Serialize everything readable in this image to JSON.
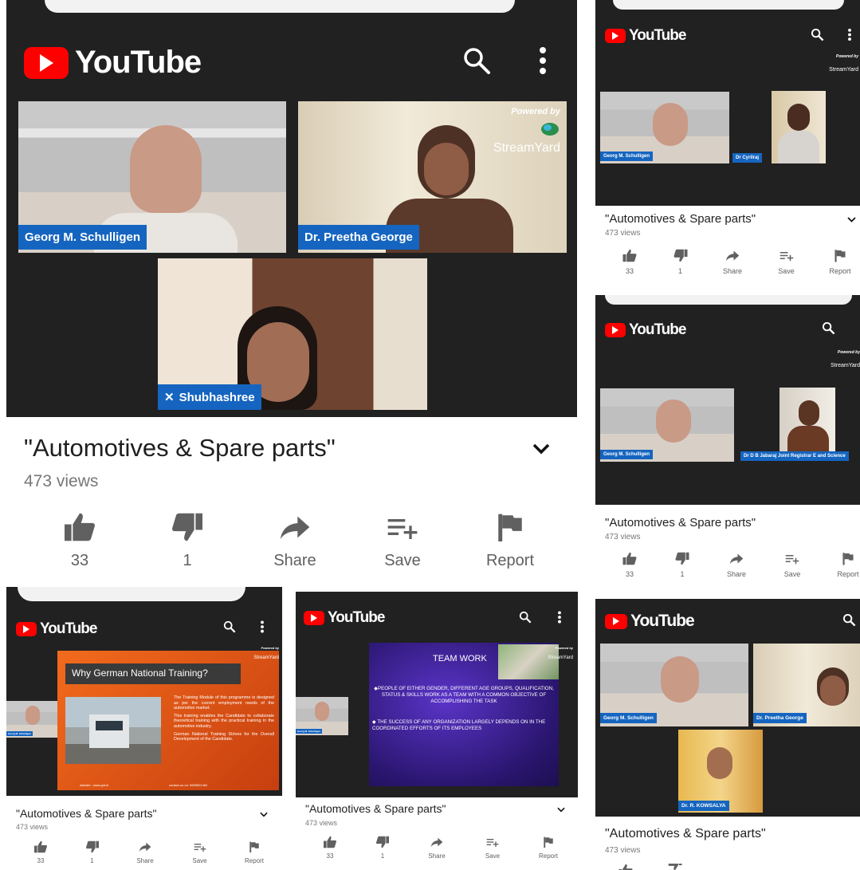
{
  "app": {
    "brand": "YouTube"
  },
  "video": {
    "title": "\"Automotives & Spare parts\"",
    "views": "473 views"
  },
  "actions": {
    "like_count": "33",
    "dislike_count": "1",
    "share": "Share",
    "save": "Save",
    "report": "Report"
  },
  "overlay": {
    "powered_by": "Powered by",
    "streamyard": "StreamYard"
  },
  "participants": {
    "georg": "Georg M. Schulligen",
    "preetha": "Dr. Preetha George",
    "shubhashree": "Shubhashree",
    "cyrilraj": "Dr Cyrilraj",
    "jabaraj": "Dr D B Jabaraj Joint Registrar E and Science",
    "kowsalya": "Dr. R. KOWSALYA"
  },
  "slide1": {
    "heading": "Why German National Training?",
    "bullets": [
      "The Training Module of this programme is designed as per the current employment needs of the automotive market.",
      "This training enables the Candidate to collaborate theoretical training with the practical training in the automotive industry.",
      "German National Training Strives for the Overall Development of the Candidate."
    ],
    "website": "website : www.gnt.in",
    "contact": "contact us on: 9655901462"
  },
  "slide2": {
    "heading": "TEAM WORK",
    "bullet1": "PEOPLE OF EITHER GENDER, DIFFERENT AGE GROUPS, QUALIFICATION, STATUS & SKILLS WORK AS A TEAM WITH A COMMON OBJECTIVE OF ACCOMPLISHING THE TASK",
    "bullet2": "THE SUCCESS OF ANY ORGANIZATION LARGELY DEPENDS ON IN THE COORDINATED EFFORTS OF ITS EMPLOYEES"
  },
  "colors": {
    "brand_red": "#ff0000",
    "topbar": "#212121",
    "nametag": "#1565c0"
  }
}
